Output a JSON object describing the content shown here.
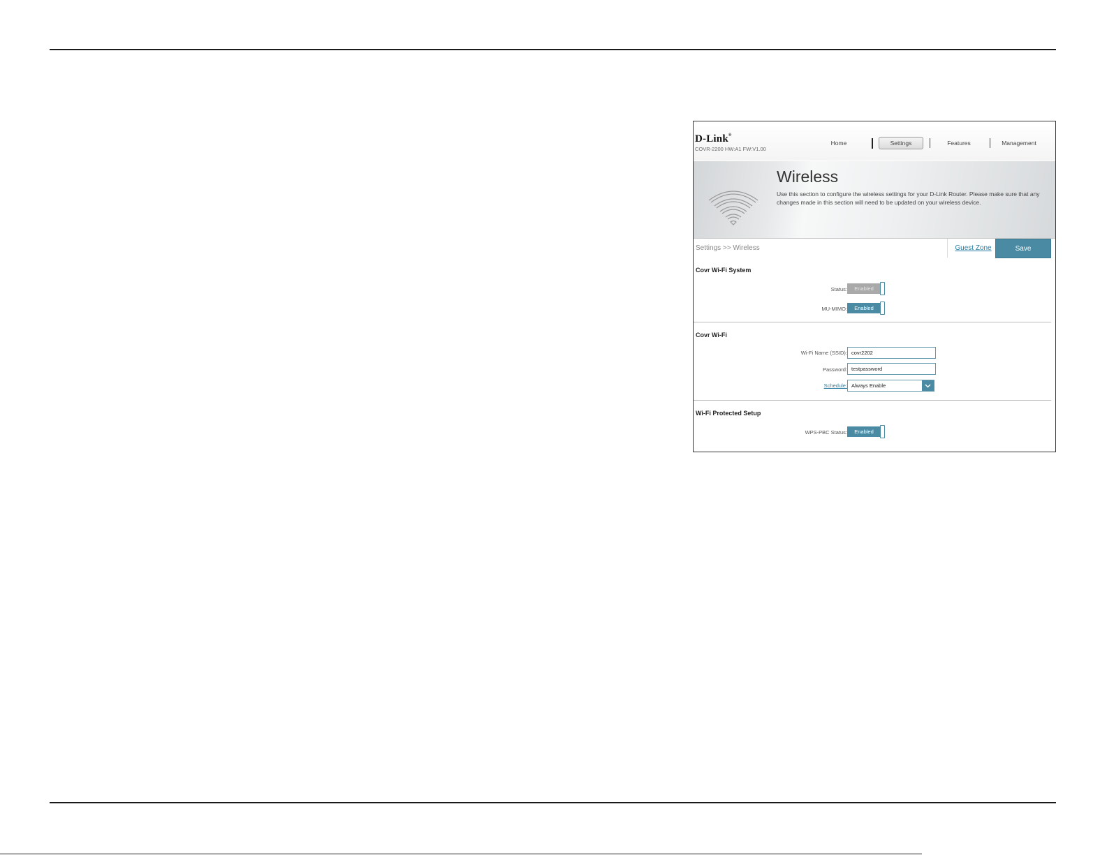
{
  "header": {
    "logo": "D-Link",
    "logo_reg": "®",
    "model": "COVR-2200 HW:A1 FW:V1.00",
    "nav": [
      "Home",
      "Settings",
      "Features",
      "Management"
    ],
    "active_nav": "Settings"
  },
  "banner": {
    "title": "Wireless",
    "description": "Use this section to configure the wireless settings for your D-Link Router. Please make sure that any changes made in this section will need to be updated on your wireless device."
  },
  "breadcrumb": "Settings >> Wireless",
  "actions": {
    "guest_zone": "Guest Zone",
    "save": "Save"
  },
  "sections": {
    "system": {
      "title": "Covr Wi-Fi System",
      "status_label": "Status:",
      "status_value": "Enabled",
      "mumimo_label": "MU-MIMO:",
      "mumimo_value": "Enabled"
    },
    "wifi": {
      "title": "Covr Wi-Fi",
      "ssid_label": "Wi-Fi Name (SSID):",
      "ssid_value": "covr2202",
      "password_label": "Password:",
      "password_value": "testpassword",
      "schedule_label": "Schedule:",
      "schedule_value": "Always Enable"
    },
    "wps": {
      "title": "Wi-Fi Protected Setup",
      "pbc_label": "WPS-PBC Status:",
      "pbc_value": "Enabled"
    }
  },
  "colors": {
    "accent": "#4a8aa3",
    "link": "#2a7ea5",
    "disabled": "#a9a9a9"
  }
}
